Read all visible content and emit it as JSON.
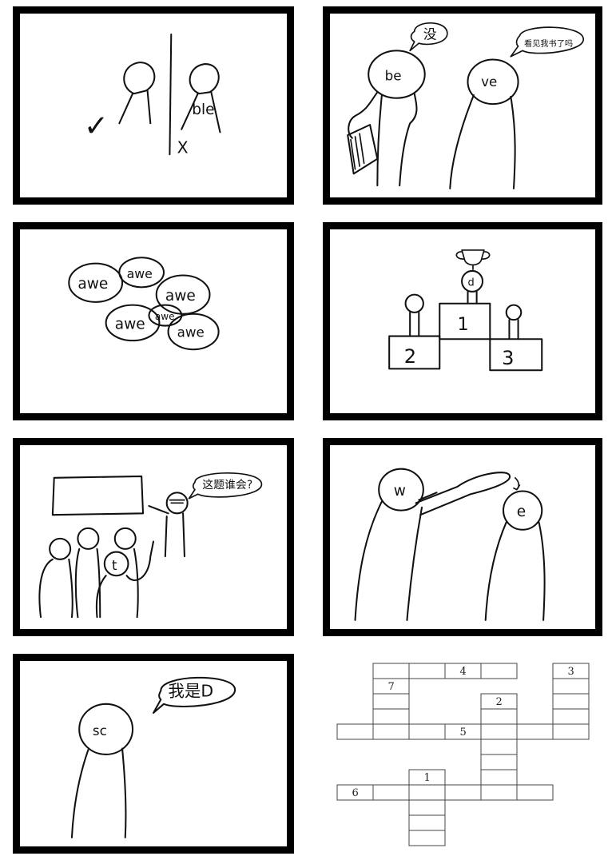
{
  "panels": {
    "p1": {
      "mark_check": "✓",
      "word": "ble",
      "mark_cross": "X"
    },
    "p2": {
      "speech_left": "没",
      "person_left": "be",
      "person_right": "ve",
      "speech_right": "看见我书了吗"
    },
    "p3": {
      "blob1": "awe",
      "blob2": "awe",
      "blob3": "awe",
      "blob4": "awe",
      "blob5": "awe",
      "blob6": "awe"
    },
    "p4": {
      "trophy_letter": "d",
      "place1": "1",
      "place2": "2",
      "place3": "3"
    },
    "p5": {
      "speech": "这题谁会?",
      "student": "t"
    },
    "p6": {
      "person_left": "w",
      "person_right": "e"
    },
    "p7": {
      "person": "sc",
      "speech": "我是D"
    }
  },
  "crossword": {
    "clue_numbers": [
      "1",
      "2",
      "3",
      "4",
      "5",
      "6",
      "7"
    ]
  }
}
